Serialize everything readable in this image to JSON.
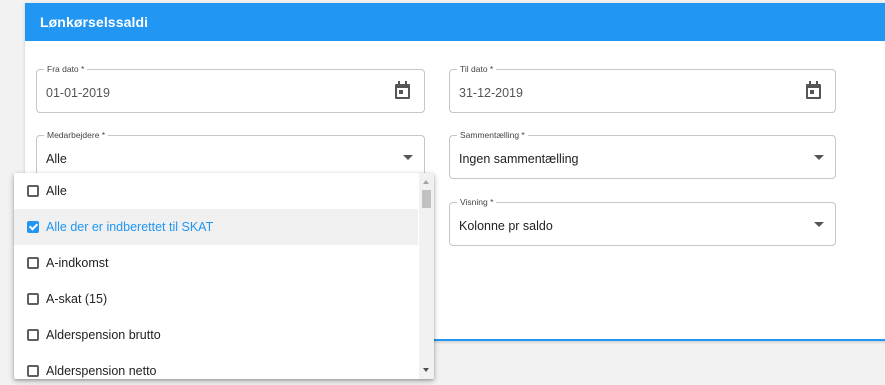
{
  "header": {
    "title": "Lønkørselssaldi"
  },
  "fields": {
    "from_date": {
      "label": "Fra dato *",
      "value": "01-01-2019",
      "icon": "calendar-icon"
    },
    "to_date": {
      "label": "Til dato *",
      "value": "31-12-2019",
      "icon": "calendar-icon"
    },
    "employees": {
      "label": "Medarbejdere *",
      "value": "Alle"
    },
    "summation": {
      "label": "Sammentælling *",
      "value": "Ingen sammentælling"
    },
    "view": {
      "label": "Visning *",
      "value": "Kolonne pr saldo"
    }
  },
  "dropdown": {
    "options": [
      {
        "label": "Alle",
        "checked": false
      },
      {
        "label": "Alle der er indberettet til SKAT",
        "checked": true
      },
      {
        "label": "A-indkomst",
        "checked": false
      },
      {
        "label": "A-skat (15)",
        "checked": false
      },
      {
        "label": "Alderspension brutto",
        "checked": false
      },
      {
        "label": "Alderspension netto",
        "checked": false
      }
    ]
  },
  "colors": {
    "accent": "#2196f3",
    "background": "#f2f2f2"
  }
}
